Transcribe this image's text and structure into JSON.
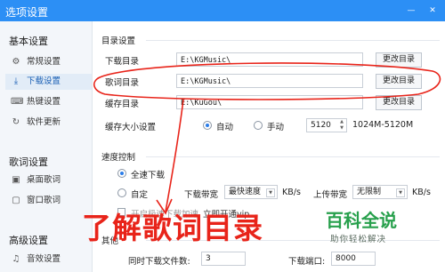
{
  "window": {
    "title": "选项设置",
    "minimize_glyph": "—",
    "close_glyph": "✕"
  },
  "sidebar": {
    "sections": [
      {
        "title": "基本设置",
        "items": [
          {
            "label": "常规设置",
            "icon": "gear-icon",
            "glyph": "⚙"
          },
          {
            "label": "下载设置",
            "icon": "download-icon",
            "glyph": "⤓",
            "active": true
          },
          {
            "label": "热键设置",
            "icon": "keyboard-icon",
            "glyph": "⌨"
          },
          {
            "label": "软件更新",
            "icon": "refresh-icon",
            "glyph": "↻"
          }
        ]
      },
      {
        "title": "歌词设置",
        "items": [
          {
            "label": "桌面歌词",
            "icon": "desktop-lyrics-icon",
            "glyph": "▣"
          },
          {
            "label": "窗口歌词",
            "icon": "window-lyrics-icon",
            "glyph": "▢"
          }
        ]
      },
      {
        "title": "高级设置",
        "items": [
          {
            "label": "音效设置",
            "icon": "sound-effect-icon",
            "glyph": "♫"
          }
        ]
      }
    ]
  },
  "catalog": {
    "title": "目录设置",
    "download_label": "下载目录",
    "download_path": "E:\\KGMusic\\",
    "lyrics_label": "歌词目录",
    "lyrics_path": "E:\\KGMusic\\",
    "cache_label": "缓存目录",
    "cache_path": "E:\\KuGou\\",
    "change_button": "更改目录",
    "cache_size_label": "缓存大小设置",
    "auto_option": "自动",
    "manual_option": "手动",
    "cache_size_value": "5120",
    "cache_range": "1024M-5120M"
  },
  "speed": {
    "title": "速度控制",
    "full_speed": "全速下载",
    "custom": "自定",
    "download_bw_label": "下载带宽",
    "download_bw_value": "最快速度",
    "unit": "KB/s",
    "upload_bw_label": "上传带宽",
    "upload_bw_value": "无限制",
    "unit2": "KB/s",
    "accelerate_label": "开启极速下载加速",
    "vip_link": "立即开通vip"
  },
  "other": {
    "title": "其他",
    "concurrent_label": "同时下载文件数:",
    "concurrent_value": "3",
    "port_label": "下载端口:",
    "port_value": "8000"
  },
  "annotation": {
    "caption": "了解歌词目录",
    "color": "#e8241a"
  },
  "watermark": {
    "main": "百科全说",
    "sub": "助你轻松解决"
  },
  "colors": {
    "titlebar": "#2c8ff5",
    "active_item": "#1a5fb4",
    "annotation": "#e8241a",
    "watermark": "#27a04c"
  }
}
